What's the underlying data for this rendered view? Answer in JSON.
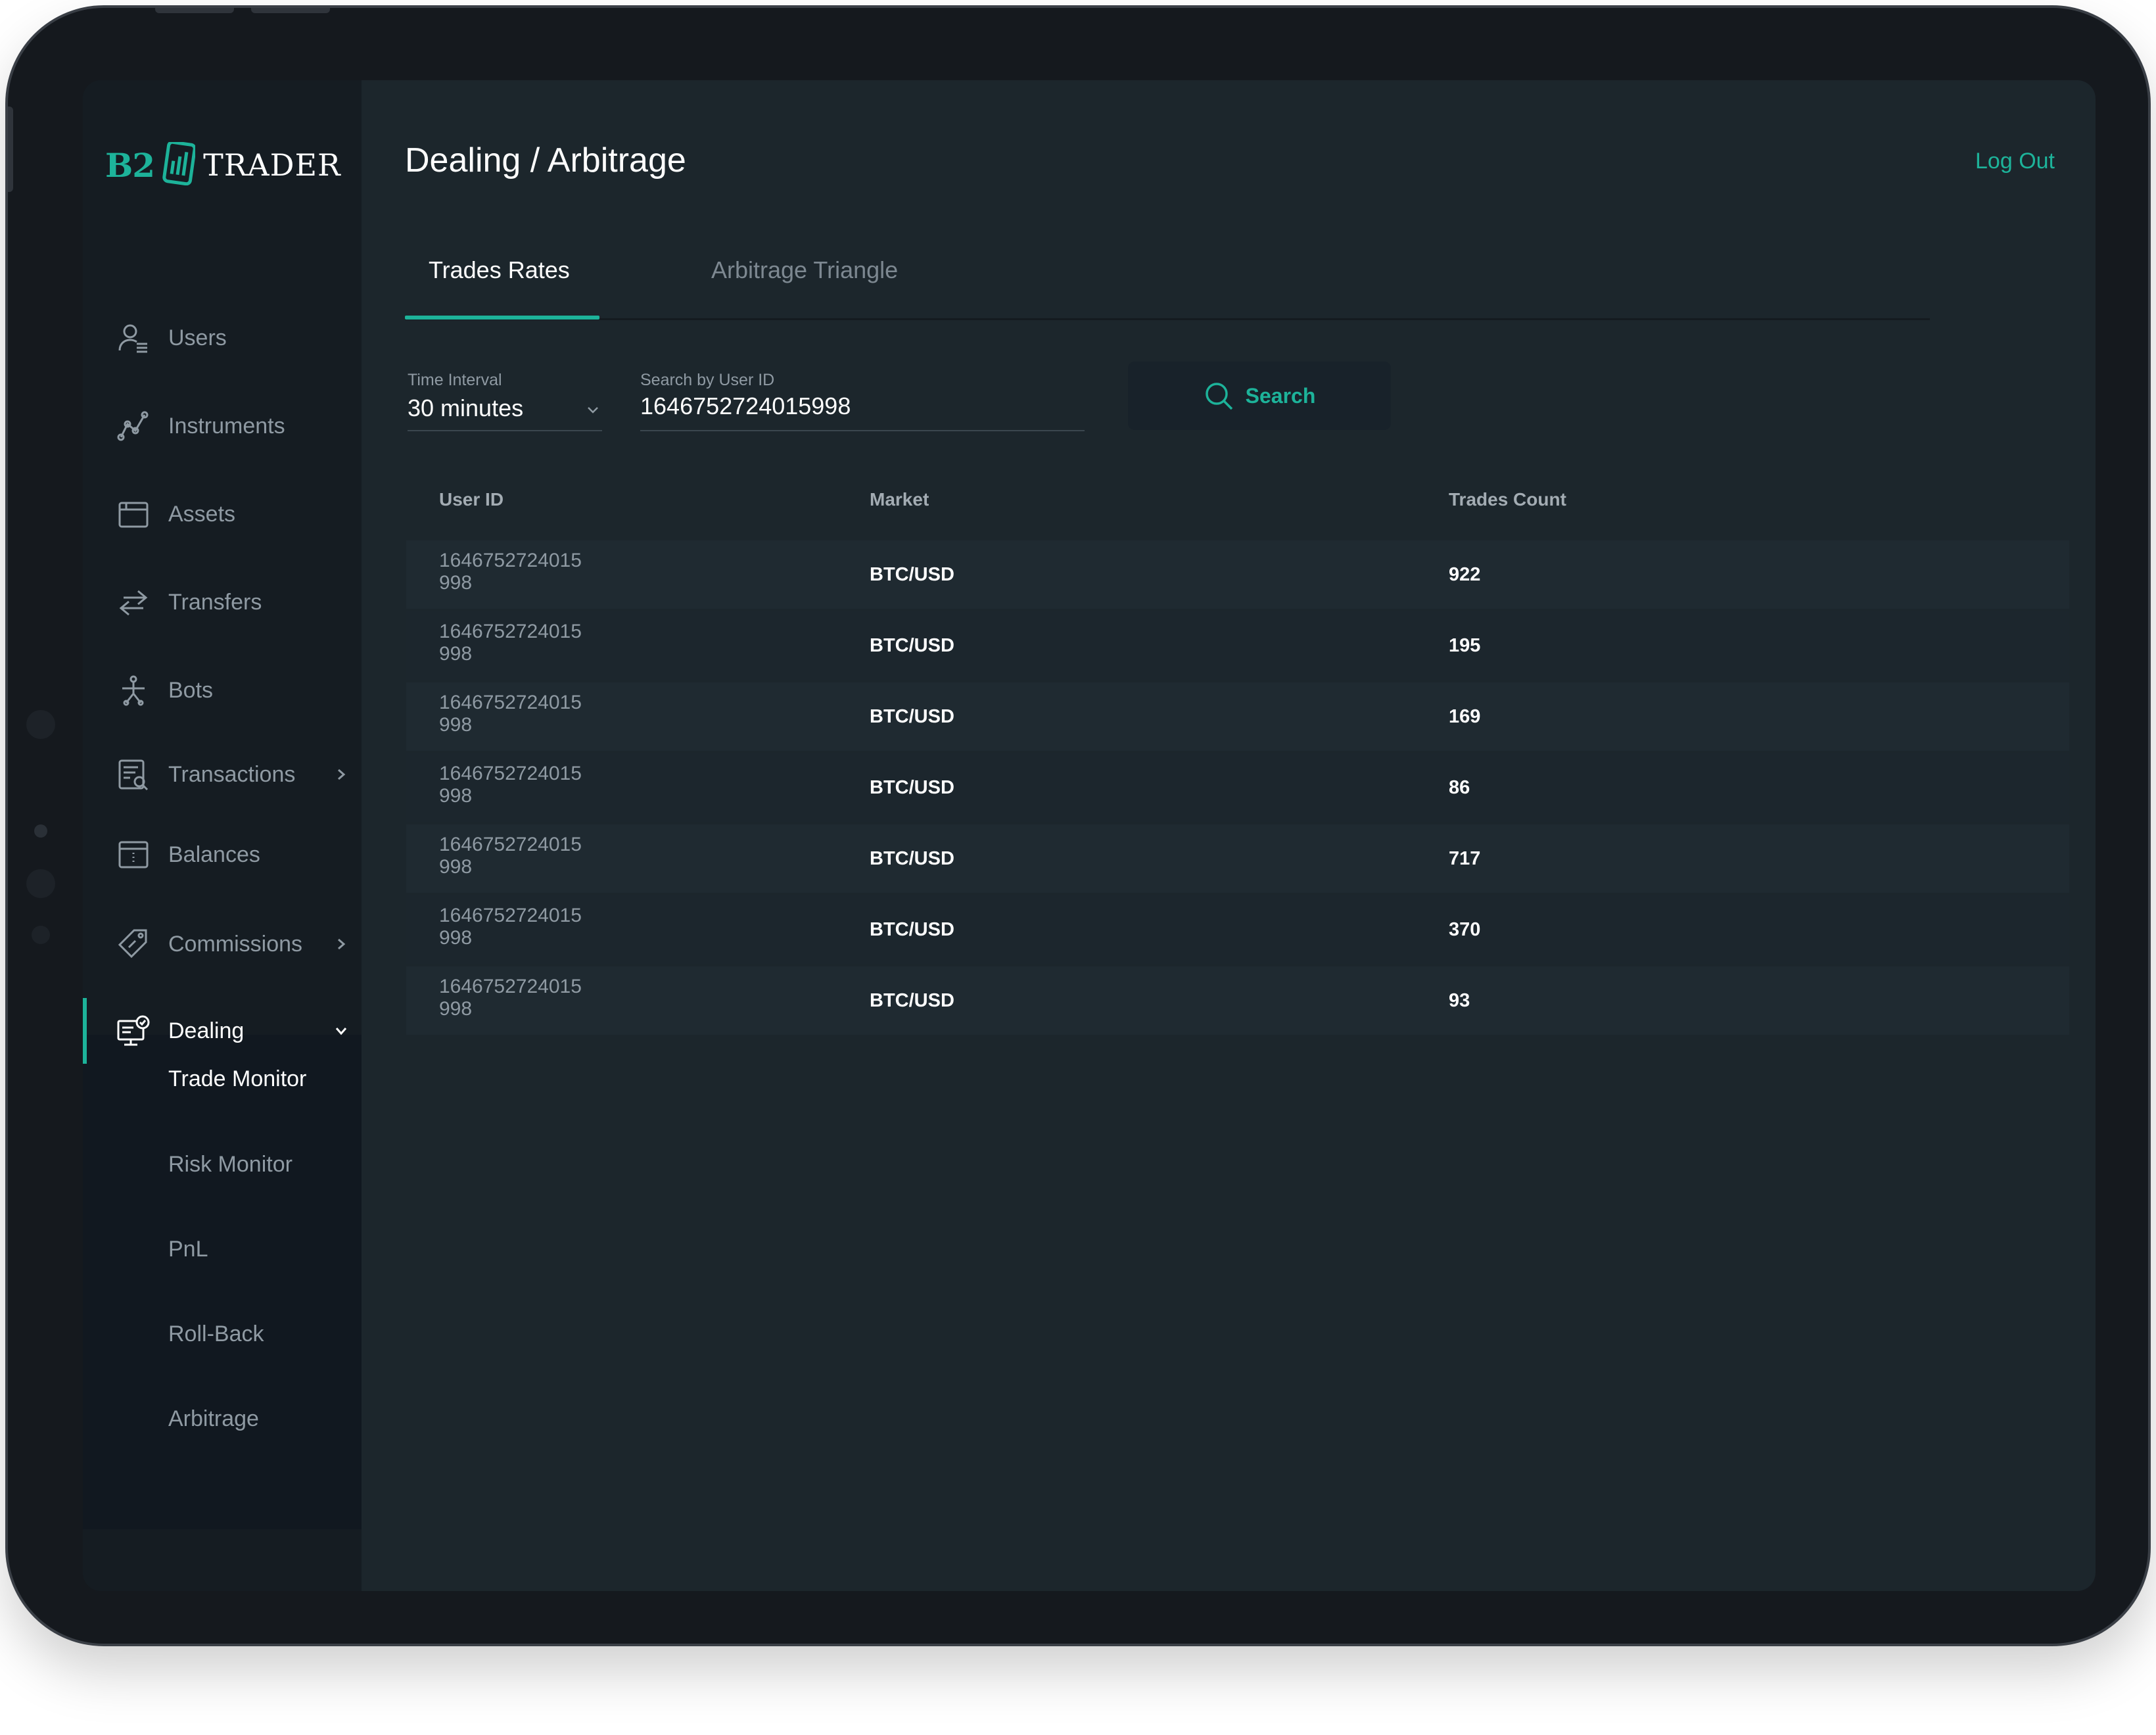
{
  "app": {
    "logo_left": "B2",
    "logo_right": "TRADER"
  },
  "sidebar": {
    "items": [
      {
        "label": "Users",
        "icon": "user-icon"
      },
      {
        "label": "Instruments",
        "icon": "instruments-icon"
      },
      {
        "label": "Assets",
        "icon": "assets-icon"
      },
      {
        "label": "Transfers",
        "icon": "transfers-icon"
      },
      {
        "label": "Bots",
        "icon": "bots-icon"
      },
      {
        "label": "Transactions",
        "icon": "transactions-icon"
      },
      {
        "label": "Balances",
        "icon": "balances-icon"
      },
      {
        "label": "Commissions",
        "icon": "commissions-icon"
      },
      {
        "label": "Dealing",
        "icon": "dealing-icon"
      }
    ],
    "dealing_submenu": [
      "Trade Monitor",
      "Risk Monitor",
      "PnL",
      "Roll-Back",
      "Arbitrage"
    ]
  },
  "header": {
    "title": "Dealing / Arbitrage",
    "logout": "Log Out"
  },
  "tabs": [
    "Trades Rates",
    "Arbitrage Triangle"
  ],
  "filters": {
    "time_interval_label": "Time Interval",
    "time_interval_value": "30 minutes",
    "user_id_label": "Search by User ID",
    "user_id_value": "1646752724015998",
    "search_label": "Search"
  },
  "table": {
    "columns": [
      "User ID",
      "Market",
      "Trades Count"
    ],
    "rows": [
      {
        "user_id": "1646752724015998",
        "market": "BTC/USD",
        "count": "922"
      },
      {
        "user_id": "1646752724015998",
        "market": "BTC/USD",
        "count": "195"
      },
      {
        "user_id": "1646752724015998",
        "market": "BTC/USD",
        "count": "169"
      },
      {
        "user_id": "1646752724015998",
        "market": "BTC/USD",
        "count": "86"
      },
      {
        "user_id": "1646752724015998",
        "market": "BTC/USD",
        "count": "717"
      },
      {
        "user_id": "1646752724015998",
        "market": "BTC/USD",
        "count": "370"
      },
      {
        "user_id": "1646752724015998",
        "market": "BTC/USD",
        "count": "93"
      }
    ]
  },
  "colors": {
    "accent": "#1db39a",
    "screen_bg": "#1c262c",
    "sidebar_bg": "#151c22"
  }
}
